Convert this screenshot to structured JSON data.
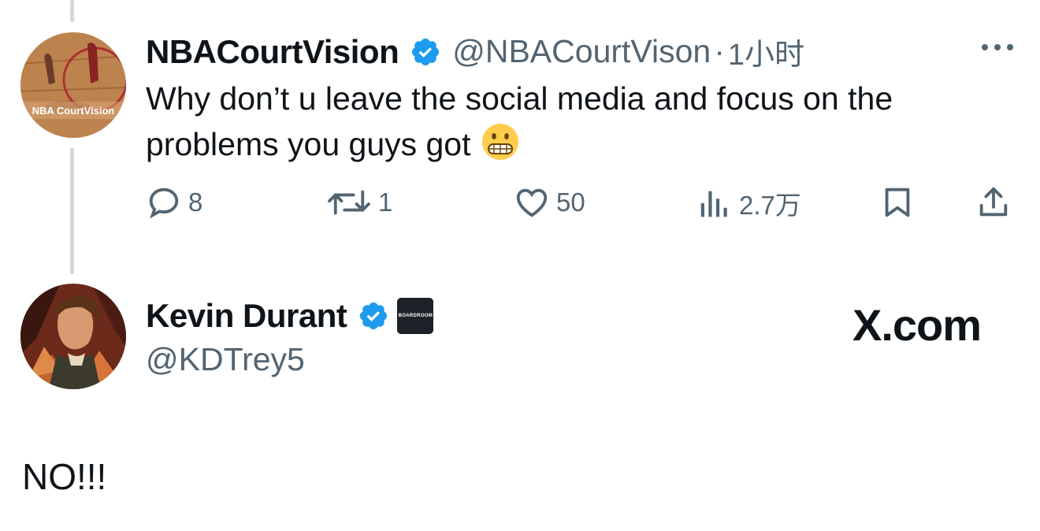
{
  "reply_tweet": {
    "display_name": "NBACourtVision",
    "handle": "@NBACourtVison",
    "separator": "·",
    "time": "1小时",
    "avatar_text": "NBA CourtVision",
    "text": "Why don’t u leave the social media and focus on the problems you guys got",
    "emoji": "grimacing-face",
    "actions": {
      "replies": "8",
      "reposts": "1",
      "likes": "50",
      "views": "2.7万"
    }
  },
  "main_tweet": {
    "display_name": "Kevin Durant",
    "handle": "@KDTrey5",
    "affiliation_badge": "BOARDROOM",
    "text": "NO!!!"
  },
  "watermark": "X.com",
  "colors": {
    "text": "#0f1419",
    "secondary": "#536471",
    "verified": "#1d9bf0",
    "thread_line": "#cfd9de"
  }
}
